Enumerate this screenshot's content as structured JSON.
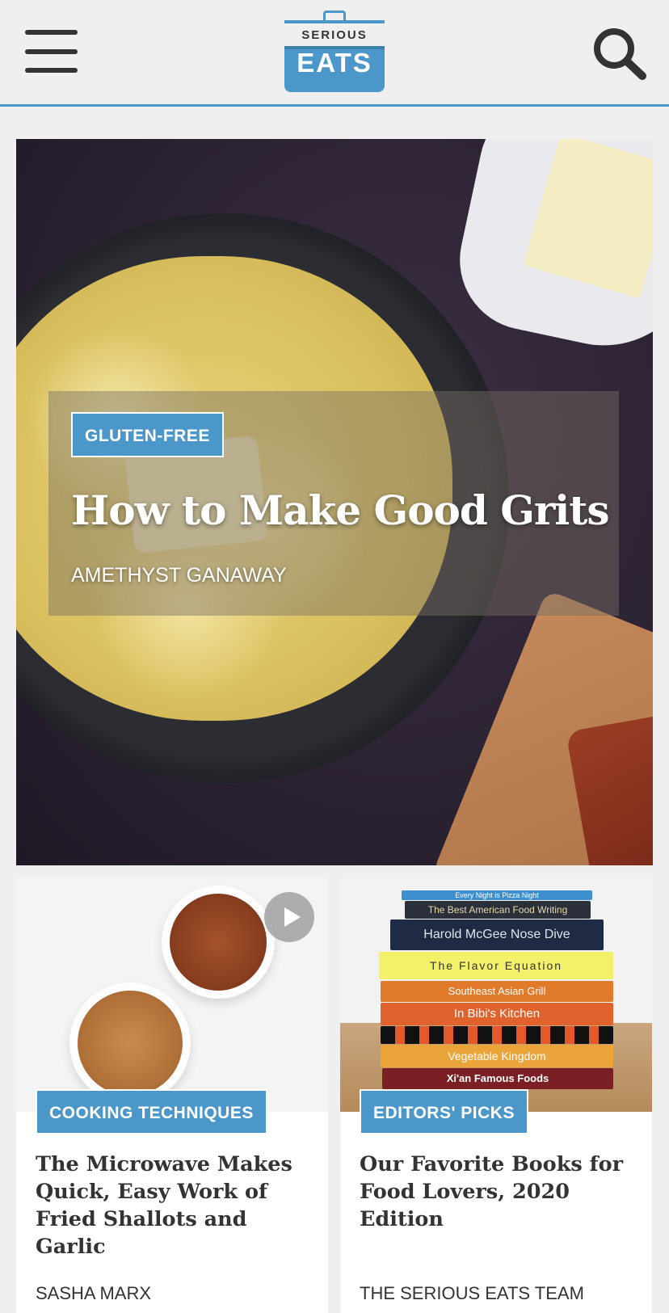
{
  "header": {
    "logo": {
      "top": "SERIOUS",
      "bottom": "EATS"
    }
  },
  "hero": {
    "tag": "GLUTEN-FREE",
    "title": "How to Make Good Grits",
    "author": "AMETHYST GANAWAY"
  },
  "cards": [
    {
      "tag": "COOKING TECHNIQUES",
      "title": "The Microwave Makes Quick, Easy Work of Fried Shallots and Garlic",
      "author": "SASHA MARX"
    },
    {
      "tag": "EDITORS' PICKS",
      "title": "Our Favorite Books for Food Lovers, 2020 Edition",
      "author": "THE SERIOUS EATS TEAM",
      "books": [
        "Every Night is Pizza Night",
        "The Best American Food Writing",
        "Harold McGee Nose Dive",
        "The Flavor Equation",
        "Southeast Asian Grill",
        "In Bibi's Kitchen",
        "",
        "Vegetable Kingdom",
        "Xi'an Famous Foods"
      ]
    }
  ],
  "colors": {
    "accent": "#4c97c9",
    "background": "#efefef",
    "text": "#333333"
  },
  "icons": [
    "menu-icon",
    "search-icon",
    "play-icon"
  ]
}
